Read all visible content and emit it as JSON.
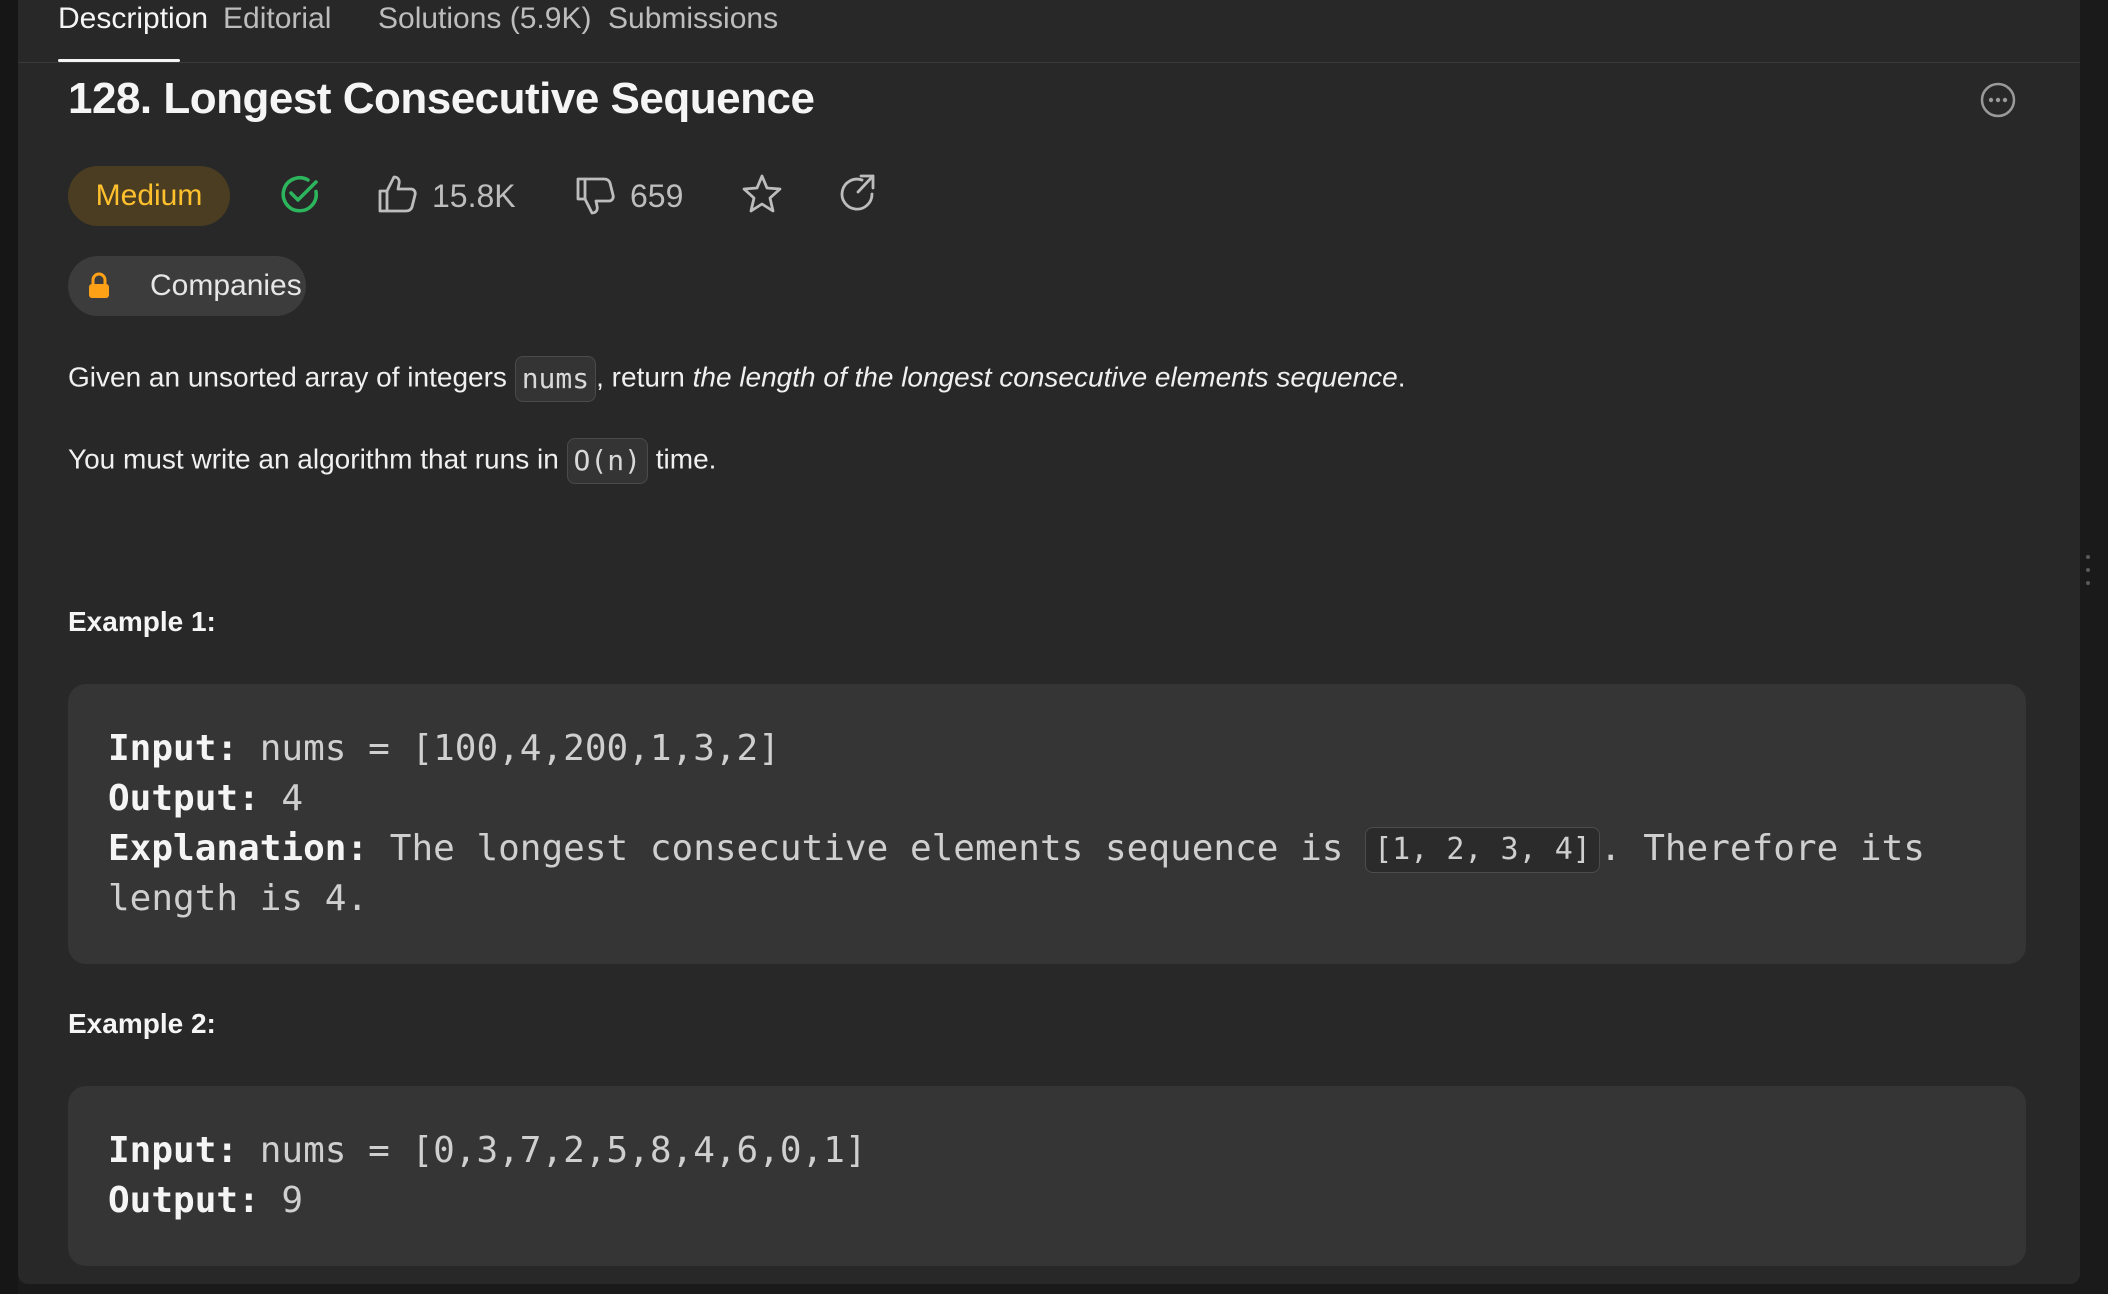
{
  "tabs": [
    {
      "label": "Description",
      "active": true
    },
    {
      "label": "Editorial",
      "active": false
    },
    {
      "label": "Solutions (5.9K)",
      "active": false
    },
    {
      "label": "Submissions",
      "active": false
    }
  ],
  "problem": {
    "title": "128. Longest Consecutive Sequence",
    "difficulty": "Medium",
    "likes": "15.8K",
    "dislikes": "659",
    "companies_label": "Companies"
  },
  "description": {
    "p1_prefix": "Given an unsorted array of integers ",
    "p1_code": "nums",
    "p1_mid": ", return ",
    "p1_em": "the length of the longest consecutive elements sequence",
    "p1_suffix": ".",
    "p2_prefix": "You must write an algorithm that runs in ",
    "p2_code": "O(n)",
    "p2_suffix": " time."
  },
  "examples": [
    {
      "heading": "Example 1:",
      "input_label": "Input:",
      "input_value": " nums = [100,4,200,1,3,2]",
      "output_label": "Output:",
      "output_value": " 4",
      "explanation_label": "Explanation:",
      "explanation_prefix": " The longest consecutive elements sequence is ",
      "explanation_code": "[1, 2, 3, 4]",
      "explanation_suffix": ". Therefore its",
      "explanation_line2": "length is 4."
    },
    {
      "heading": "Example 2:",
      "input_label": "Input:",
      "input_value": " nums = [0,3,7,2,5,8,4,6,0,1]",
      "output_label": "Output:",
      "output_value": " 9"
    }
  ],
  "icons": {
    "solved": "check-circle-icon",
    "like": "thumbs-up-icon",
    "dislike": "thumbs-down-icon",
    "favorite": "star-icon",
    "share": "share-icon",
    "lock": "lock-icon",
    "more": "more-options-icon"
  },
  "colors": {
    "medium_text": "#ffc02e",
    "medium_bg": "#4a3d21",
    "solved_green": "#2db55d",
    "lock_orange": "#ffa116"
  }
}
